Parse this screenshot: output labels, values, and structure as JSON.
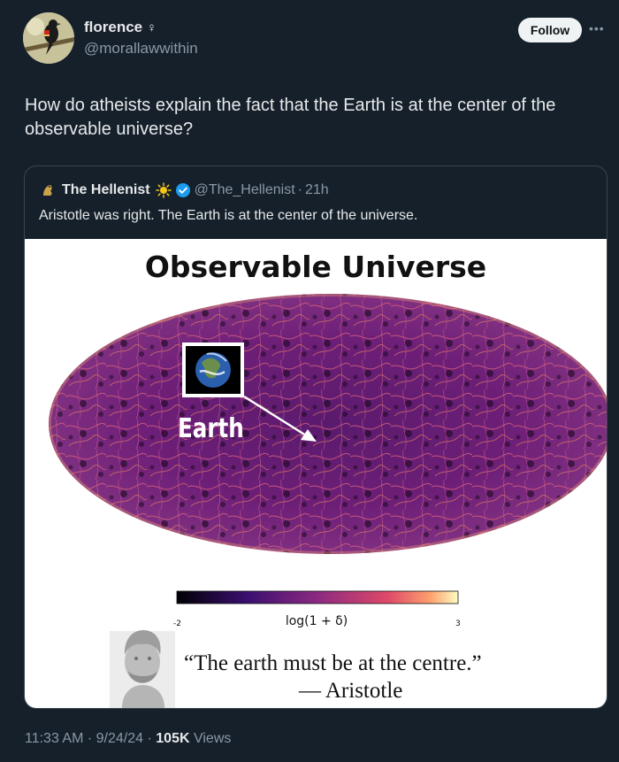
{
  "author": {
    "display_name": "florence",
    "name_glyph": "♀",
    "handle": "@morallawwithin",
    "follow_label": "Follow"
  },
  "tweet": {
    "text": "How do atheists explain the fact that the Earth is at the center of the observable universe?"
  },
  "quote": {
    "display_name": "The Hellenist",
    "handle": "@The_Hellenist",
    "separator": "·",
    "time": "21h",
    "text": "Aristotle was right. The Earth is at the center of the universe.",
    "image": {
      "title": "Observable Universe",
      "earth_label": "Earth",
      "colorbar_label": "log(1 + δ)",
      "colorbar_min": "-2",
      "colorbar_max": "3",
      "quote_line": "“The earth must be at the centre.”",
      "quote_author": "— Aristotle"
    }
  },
  "meta": {
    "time": "11:33 AM",
    "date": "9/24/24",
    "separator": "·",
    "views_count": "105K",
    "views_label": "Views"
  },
  "colors": {
    "background": "#15202b",
    "text": "#e7e9ea",
    "muted": "#8b98a5",
    "verified": "#1d9bf0"
  }
}
